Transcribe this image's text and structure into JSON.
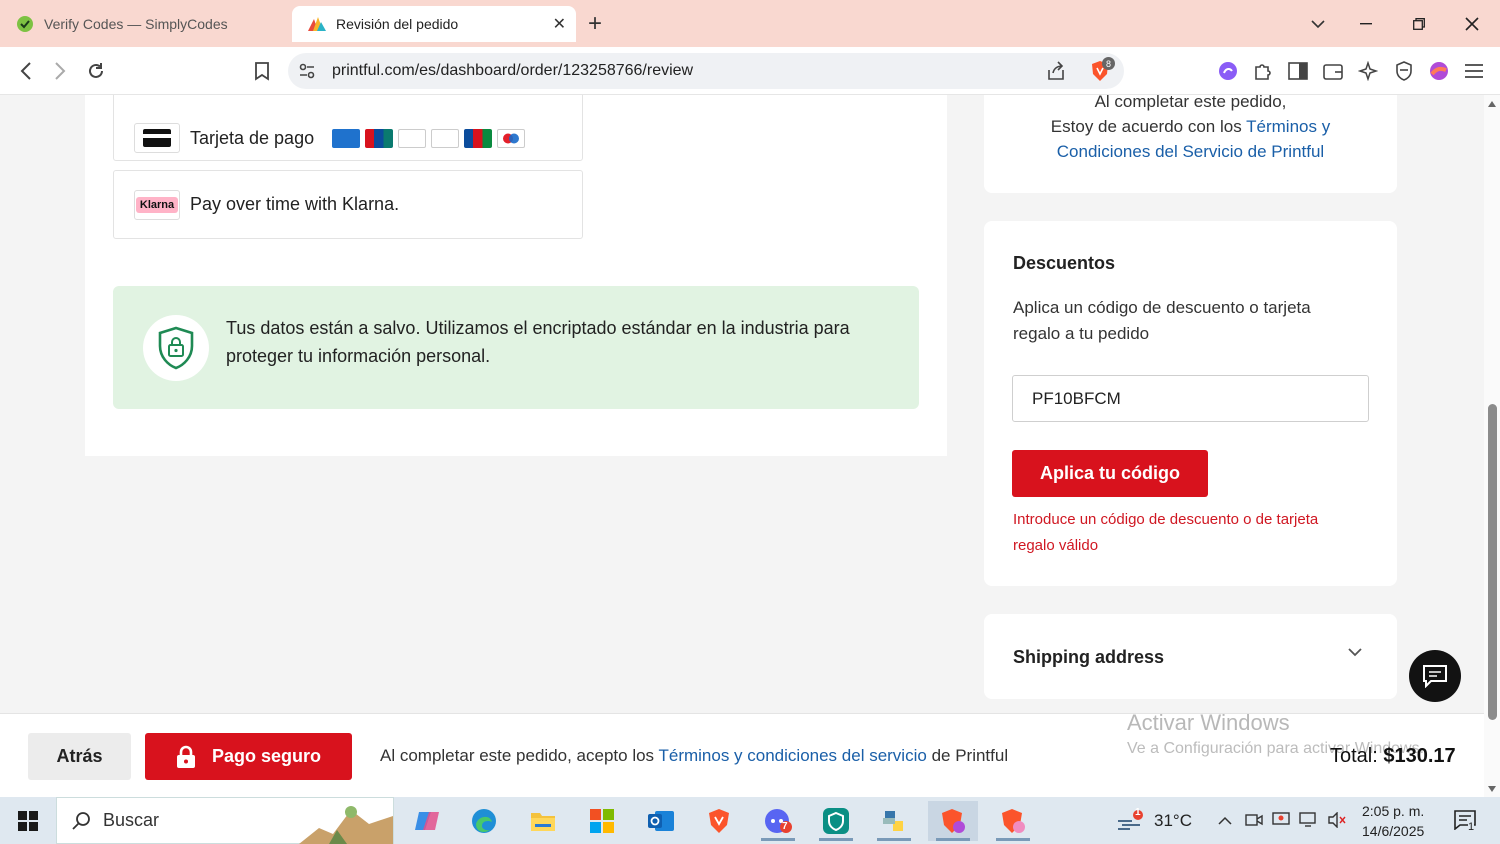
{
  "browser": {
    "tabs": [
      {
        "title": "Verify Codes — SimplyCodes"
      },
      {
        "title": "Revisión del pedido"
      }
    ],
    "new_tab_symbol": "+",
    "url": "printful.com/es/dashboard/order/123258766/review",
    "brave_badge": "8"
  },
  "payment_methods": {
    "card_label": "Tarjeta de pago",
    "klarna_label": "Pay over time with Klarna.",
    "klarna_logo_text": "Klarna",
    "card_brands": [
      "amex-icon",
      "unionpay-icon",
      "diners-icon",
      "discover-icon",
      "jcb-icon",
      "maestro-icon"
    ]
  },
  "security": {
    "text": "Tus datos están a salvo. Utilizamos el encriptado estándar en la industria para proteger tu información personal."
  },
  "terms_card": {
    "line1": "Al completar este pedido,",
    "line2": "Estoy de acuerdo con los",
    "link": "Términos y Condiciones del Servicio de Printful"
  },
  "discounts": {
    "title": "Descuentos",
    "description": "Aplica un código de descuento o tarjeta regalo a tu pedido",
    "code_value": "PF10BFCM",
    "apply_label": "Aplica tu código",
    "error": "Introduce un código de descuento o de tarjeta regalo válido"
  },
  "shipping": {
    "title": "Shipping address"
  },
  "footer": {
    "back_label": "Atrás",
    "pay_label": "Pago seguro",
    "terms_prefix": "Al completar este pedido, acepto los",
    "terms_link": "Términos y condiciones del servicio",
    "terms_suffix": "de Printful",
    "total_label": "Total:",
    "total_value": "$130.17"
  },
  "watermark": {
    "line1": "Activar Windows",
    "line2": "Ve a Configuración para activar Windows."
  },
  "taskbar": {
    "search_placeholder": "Buscar",
    "temperature": "31°C",
    "weather_badge": "1",
    "time": "2:05 p. m.",
    "date": "14/6/2025",
    "notification_count": "1",
    "discord_badge": "7"
  },
  "colors": {
    "accent_red": "#d8121d",
    "link_blue": "#1a5fa8",
    "secure_bg": "#e1f3e2",
    "tab_strip": "#f9d8d0"
  }
}
